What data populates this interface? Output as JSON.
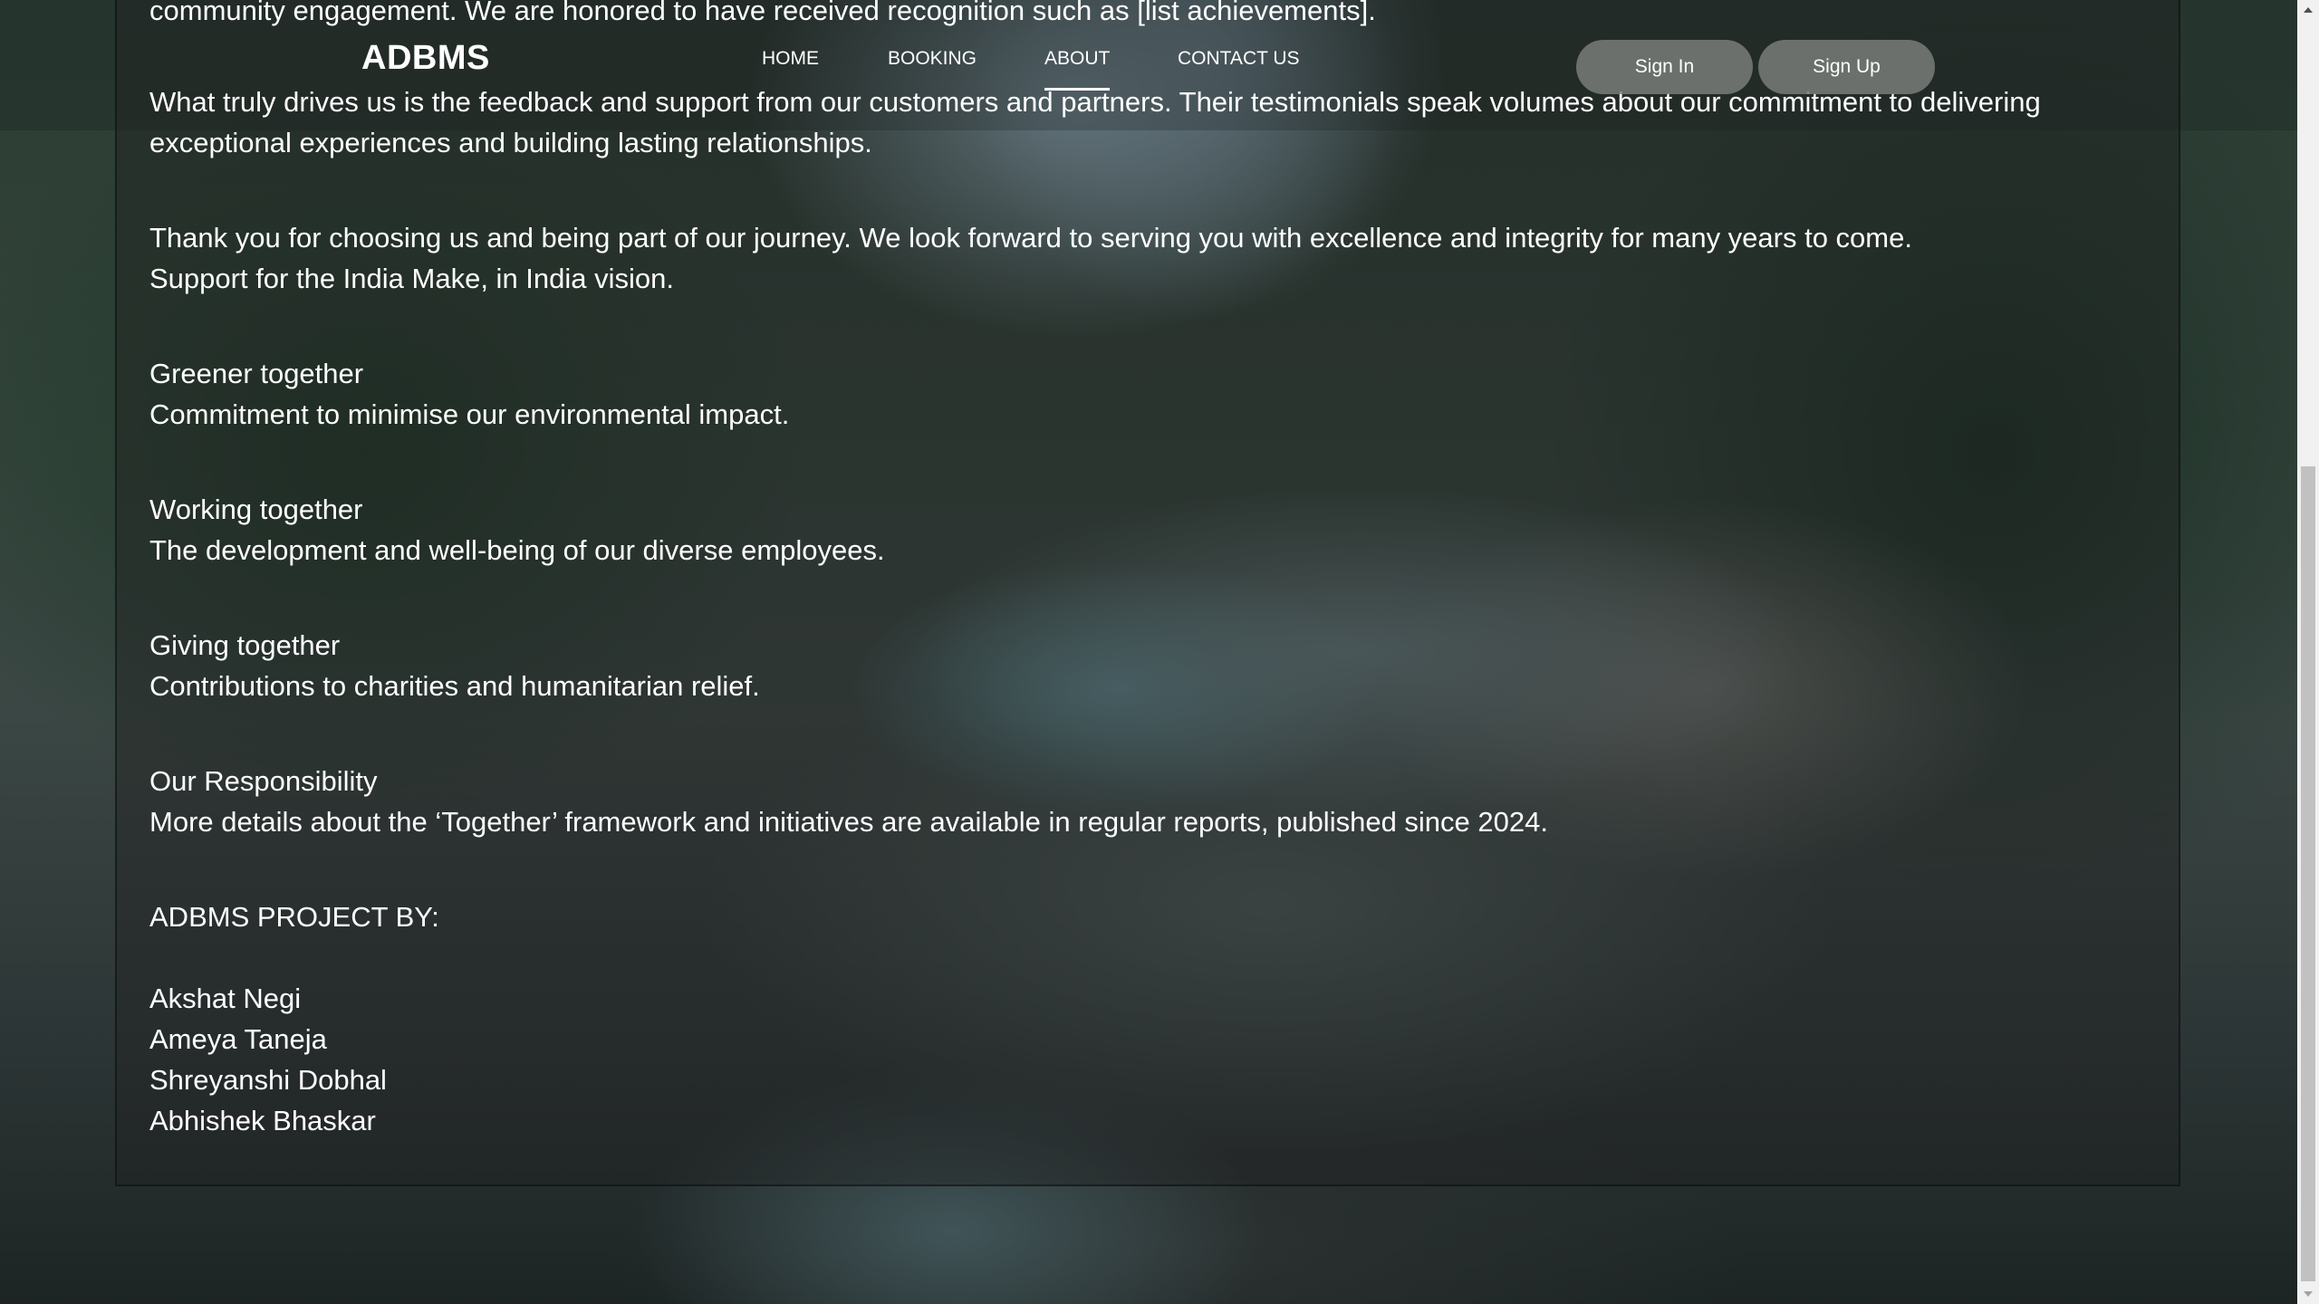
{
  "navbar": {
    "brand": "ADBMS",
    "links": [
      {
        "label": "HOME"
      },
      {
        "label": "BOOKING"
      },
      {
        "label": "ABOUT"
      },
      {
        "label": "CONTACT US"
      }
    ],
    "sign_in": "Sign In",
    "sign_up": "Sign Up"
  },
  "content": {
    "intro_tail": "community engagement. We are honored to have received recognition such as [list achievements].",
    "feedback_line1": "What truly drives us is the feedback and support from our customers and partners. Their testimonials speak volumes about our commitment to delivering",
    "feedback_line2": "exceptional experiences and building lasting relationships.",
    "thanks_line1": "Thank you for choosing us and being part of our journey. We look forward to serving you with excellence and integrity for many years to come.",
    "thanks_line2": "Support for the India Make, in India vision.",
    "sections": [
      {
        "title": "Greener together",
        "text": "Commitment to minimise our environmental impact."
      },
      {
        "title": "Working together",
        "text": "The development and well-being of our diverse employees."
      },
      {
        "title": "Giving together",
        "text": "Contributions to charities and humanitarian relief."
      },
      {
        "title": "Our Responsibility",
        "text": "More details about the ‘Together’ framework and initiatives are available in regular reports, published since 2024."
      }
    ],
    "project_by": "ADBMS PROJECT BY:",
    "members": [
      "Akshat Negi",
      "Ameya Taneja",
      "Shreyanshi Dobhal",
      "Abhishek Bhaskar"
    ]
  },
  "colors": {
    "text": "#ffffff",
    "button_bg": "#787d7a",
    "scrollbar_track": "#f1f1f1",
    "scrollbar_thumb": "#c1c1c1"
  }
}
